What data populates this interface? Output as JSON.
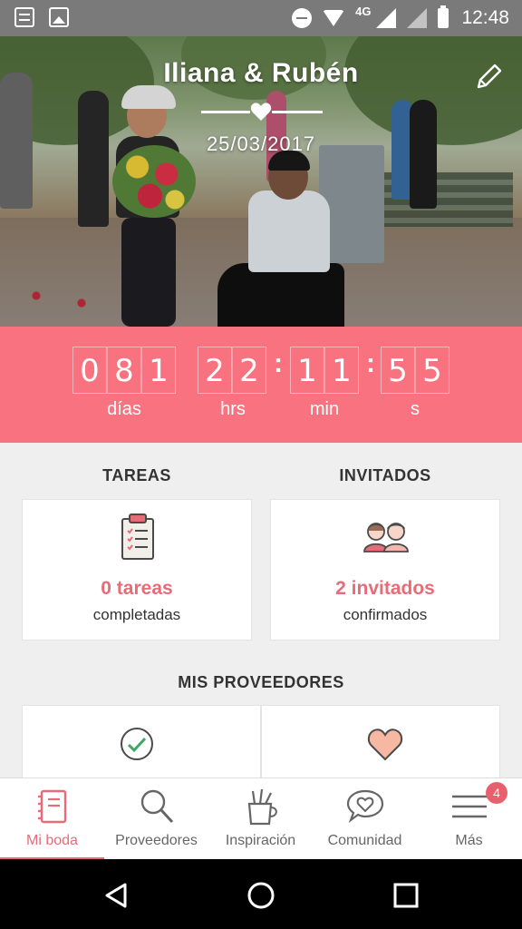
{
  "status_bar": {
    "network": "4G",
    "time": "12:48"
  },
  "hero": {
    "couple_name": "Iliana & Rubén",
    "wedding_date": "25/03/2017"
  },
  "countdown": {
    "days_digits": [
      "0",
      "8",
      "1"
    ],
    "hours_digits": [
      "2",
      "2"
    ],
    "minutes_digits": [
      "1",
      "1"
    ],
    "seconds_digits": [
      "5",
      "5"
    ],
    "separator": ":",
    "labels": {
      "days": "días",
      "hours": "hrs",
      "minutes": "min",
      "seconds": "s"
    },
    "background_color": "#f8737f"
  },
  "tasks": {
    "title": "TAREAS",
    "count": "0 tareas",
    "subtitle": "completadas",
    "icon": "clipboard-checklist-icon"
  },
  "guests": {
    "title": "INVITADOS",
    "count": "2 invitados",
    "subtitle": "confirmados",
    "icon": "couple-avatars-icon"
  },
  "vendors": {
    "title": "MIS PROVEEDORES",
    "left_icon": "checkmark-circle-icon",
    "right_icon": "heart-icon"
  },
  "bottom_nav": {
    "items": [
      {
        "label": "Mi boda",
        "icon": "notebook-icon",
        "active": true
      },
      {
        "label": "Proveedores",
        "icon": "search-icon",
        "active": false
      },
      {
        "label": "Inspiración",
        "icon": "pencil-cup-icon",
        "active": false
      },
      {
        "label": "Comunidad",
        "icon": "chat-heart-icon",
        "active": false
      },
      {
        "label": "Más",
        "icon": "menu-icon",
        "active": false,
        "badge": "4"
      }
    ],
    "accent_color": "#e86c78"
  }
}
